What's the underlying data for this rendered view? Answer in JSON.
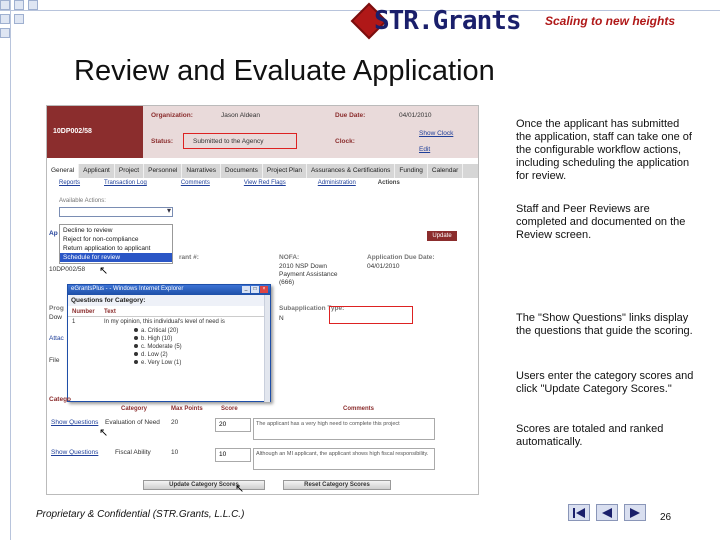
{
  "brand": {
    "name": "STR.Grants",
    "tagline": "Scaling to new heights"
  },
  "slide": {
    "title": "Review and Evaluate Application"
  },
  "app": {
    "record_id": "10DP002/58",
    "organization_label": "Organization:",
    "organization_value": "Jason Aldean",
    "status_label": "Status:",
    "status_value": "Submitted to the Agency",
    "due_date_label": "Due Date:",
    "due_date_value": "04/01/2010",
    "clock_label": "Clock:",
    "show_clock": "Show Clock",
    "edit": "Edit",
    "tabs": [
      "General",
      "Applicant",
      "Project",
      "Personnel",
      "Narratives",
      "Documents",
      "Project Plan",
      "Assurances & Certifications",
      "Funding",
      "Calendar"
    ],
    "subtabs": [
      "Reports",
      "Transaction Log",
      "Comments",
      "View Red Flags",
      "Administration",
      "Actions"
    ],
    "available_actions_label": "Available Actions:",
    "action_options": [
      "Decline to review",
      "Reject for non-compliance",
      "Return application to applicant",
      "Schedule for review"
    ],
    "update_button": "Update",
    "grant_label": "rant #:",
    "grant_value": "10DP002/58",
    "nofa_label": "NOFA:",
    "nofa_lines": [
      "2010 NSP Down",
      "Payment Assistance",
      "(666)"
    ],
    "app_due_label": "Application Due Date:",
    "app_due_value": "04/01/2010",
    "subapp_label": "Subapplication Type:",
    "subapp_value": "N",
    "left_fragments": [
      "Ap",
      "Prog",
      "Dow",
      "Attac",
      "File"
    ]
  },
  "popup": {
    "title": "eGrantsPlus - - Windows Internet Explorer",
    "subtitle": "Questions for Category:",
    "col_number": "Number",
    "col_text": "Text",
    "row_number": "1",
    "row_text": "In my opinion, this individual's level of need is",
    "options": [
      "a. Critical (20)",
      "b. High (10)",
      "c. Moderate (5)",
      "d. Low (2)",
      "e. Very Low (1)"
    ]
  },
  "categories": {
    "section_label": "Catego",
    "headers": [
      "Category",
      "Max Points",
      "Score",
      "Comments"
    ],
    "rows": [
      {
        "link": "Show Questions",
        "category": "Evaluation of Need",
        "max": "20",
        "score": "20",
        "comment": "The applicant has a very high need to complete this project"
      },
      {
        "link": "Show Questions",
        "category": "Fiscal Ability",
        "max": "10",
        "score": "10",
        "comment": "Although an MI applicant, the applicant shows high fiscal responsibility."
      }
    ],
    "update_button": "Update Category Scores",
    "reset_button": "Reset Category Scores"
  },
  "notes": [
    "Once the applicant has submitted the application, staff can take one of the configurable workflow actions, including scheduling the application for review.",
    "Staff and Peer Reviews are completed and documented on the Review screen.",
    "The \"Show Questions\" links display the questions that guide the scoring.",
    "Users enter the category scores and click \"Update Category Scores.\"",
    "Scores are totaled and ranked automatically."
  ],
  "footer": {
    "text": "Proprietary & Confidential (STR.Grants, L.L.C.)",
    "page": "26"
  },
  "colors": {
    "brand_red": "#b01818",
    "brand_navy": "#1a1f6b",
    "header_maroon": "#8b2d2d",
    "highlight_red": "#dd2222"
  }
}
